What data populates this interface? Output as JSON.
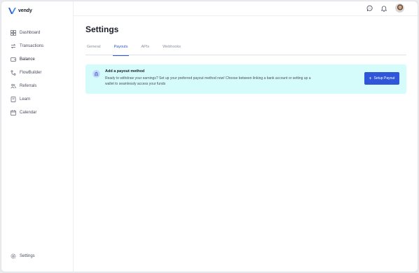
{
  "brand": {
    "name": "vendy",
    "accent": "#2f56d8"
  },
  "sidebar": {
    "items": [
      {
        "label": "Dashboard",
        "icon": "grid-icon"
      },
      {
        "label": "Transactions",
        "icon": "transactions-icon"
      },
      {
        "label": "Balance",
        "icon": "wallet-icon"
      },
      {
        "label": "FlowBuilder",
        "icon": "flow-icon"
      },
      {
        "label": "Referrals",
        "icon": "users-icon"
      },
      {
        "label": "Learn",
        "icon": "book-icon"
      },
      {
        "label": "Calendar",
        "icon": "calendar-icon"
      }
    ],
    "settings_label": "Settings"
  },
  "topbar": {
    "icons": [
      "chat-icon",
      "bell-icon",
      "avatar"
    ]
  },
  "main": {
    "title": "Settings",
    "tabs": [
      {
        "label": "General",
        "active": false
      },
      {
        "label": "Payouts",
        "active": true
      },
      {
        "label": "APIs",
        "active": false
      },
      {
        "label": "Webhooks",
        "active": false
      }
    ],
    "banner": {
      "title": "Add a payout method",
      "description": "Ready to withdraw your earnings? Set up your preferred payout method now! Choose between linking a bank account or setting up a wallet to seamlessly access your funds",
      "button_label": "Setup Payout",
      "background": "#d6fbfb"
    }
  }
}
